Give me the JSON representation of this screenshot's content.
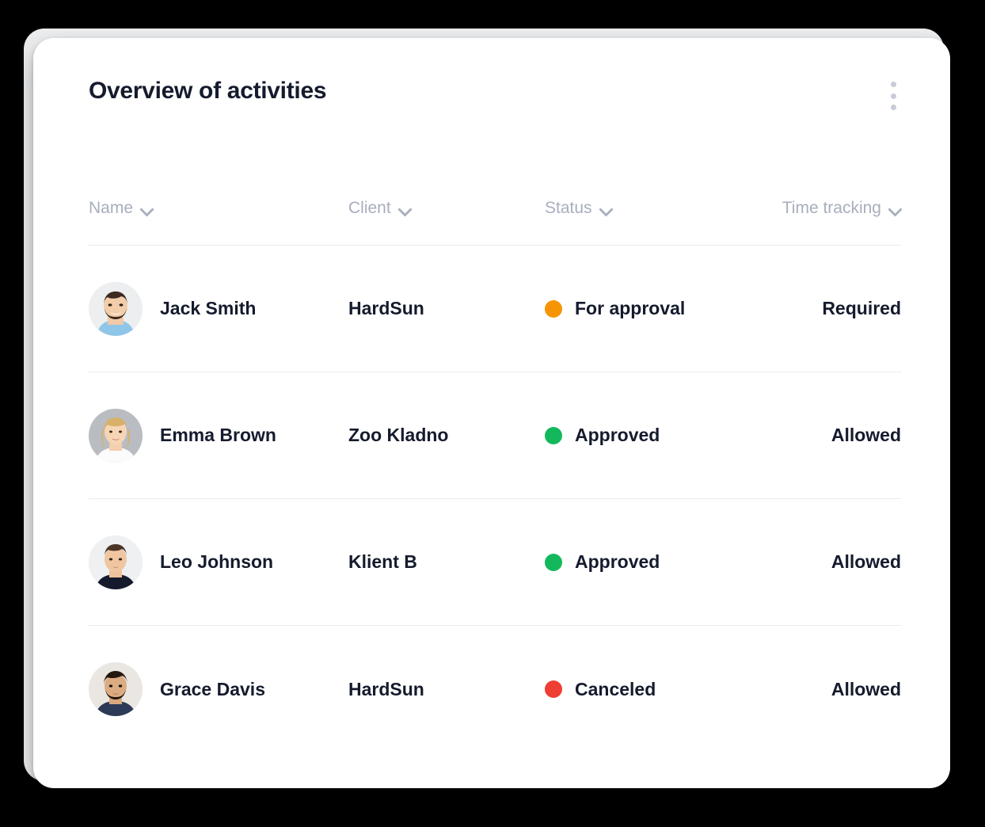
{
  "header": {
    "title": "Overview of activities",
    "menu_icon": "kebab-menu-icon"
  },
  "table": {
    "columns": [
      {
        "label": "Name",
        "sort_icon": "chevron-down-icon",
        "align": "left"
      },
      {
        "label": "Client",
        "sort_icon": "chevron-down-icon",
        "align": "left"
      },
      {
        "label": "Status",
        "sort_icon": "chevron-down-icon",
        "align": "left"
      },
      {
        "label": "Time tracking",
        "sort_icon": "chevron-down-icon",
        "align": "right"
      }
    ],
    "rows": [
      {
        "avatar": "avatar-jack-smith",
        "name": "Jack Smith",
        "client": "HardSun",
        "status": "For approval",
        "status_color": "#f59505",
        "time_tracking": "Required"
      },
      {
        "avatar": "avatar-emma-brown",
        "name": "Emma Brown",
        "client": "Zoo Kladno",
        "status": "Approved",
        "status_color": "#14b85c",
        "time_tracking": "Allowed"
      },
      {
        "avatar": "avatar-leo-johnson",
        "name": "Leo Johnson",
        "client": "Klient B",
        "status": "Approved",
        "status_color": "#14b85c",
        "time_tracking": "Allowed"
      },
      {
        "avatar": "avatar-grace-davis",
        "name": "Grace Davis",
        "client": "HardSun",
        "status": "Canceled",
        "status_color": "#ef3e33",
        "time_tracking": "Allowed"
      }
    ]
  },
  "colors": {
    "page_background": "#000000",
    "card_background": "#ffffff",
    "text_primary": "#151b2d",
    "text_muted": "#a8aebd",
    "divider": "#e8eaee",
    "status_orange": "#f59505",
    "status_green": "#14b85c",
    "status_red": "#ef3e33"
  }
}
